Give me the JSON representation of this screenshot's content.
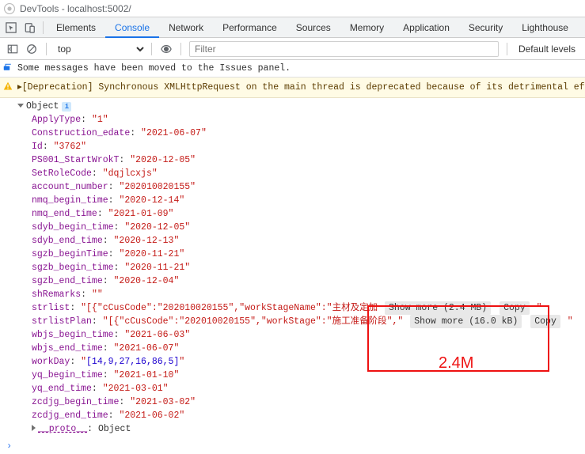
{
  "title": "DevTools - localhost:5002/",
  "tabs": [
    "Elements",
    "Console",
    "Network",
    "Performance",
    "Sources",
    "Memory",
    "Application",
    "Security",
    "Lighthouse"
  ],
  "activeTab": "Console",
  "toolbar": {
    "context": "top",
    "filterPlaceholder": "Filter",
    "levels": "Default levels"
  },
  "issues_msg": "Some messages have been moved to the Issues panel.",
  "deprecation": "▸[Deprecation] Synchronous XMLHttpRequest on the main thread is deprecated because of its detrimental effect",
  "object_label": "Object",
  "props": {
    "ApplyType": "\"1\"",
    "Construction_edate": "\"2021-06-07\"",
    "Id": "\"3762\"",
    "PS001_StartWrokT": "\"2020-12-05\"",
    "SetRoleCode": "\"dqjlcxjs\"",
    "account_number": "\"202010020155\"",
    "nmq_begin_time": "\"2020-12-14\"",
    "nmq_end_time": "\"2021-01-09\"",
    "sdyb_begin_time": "\"2020-12-05\"",
    "sdyb_end_time": "\"2020-12-13\"",
    "sgzb_beginTime": "\"2020-11-21\"",
    "sgzb_begin_time": "\"2020-11-21\"",
    "sgzb_end_time": "\"2020-12-04\"",
    "shRemarks": "\"\"",
    "wbjs_begin_time": "\"2021-06-03\"",
    "wbjs_end_time": "\"2021-06-07\"",
    "yq_begin_time": "\"2021-01-10\"",
    "yq_end_time": "\"2021-03-01\"",
    "zcdjg_begin_time": "\"2021-03-02\"",
    "zcdjg_end_time": "\"2021-06-02\""
  },
  "strlist_prefix": "\"[{\"cCusCode\":\"202010020155\",\"workStageName\":\"",
  "strlist_cn": "主材及定加",
  "strlist_showmore": "Show more (2.4 MB)",
  "strlistPlan_prefix": "\"[{\"cCusCode\":\"202010020155\",\"workStage\":\"",
  "strlistPlan_cn": "施工准备阶段\",\"",
  "strlistPlan_showmore": "Show more (16.0 kB)",
  "copy_label": "Copy",
  "trailing_quote": "\"",
  "workDay_key": "workDay",
  "workDay_val": "[14,9,27,16,86,5]",
  "proto_key": "__proto__",
  "proto_val": "Object",
  "annotation": "2.4M"
}
